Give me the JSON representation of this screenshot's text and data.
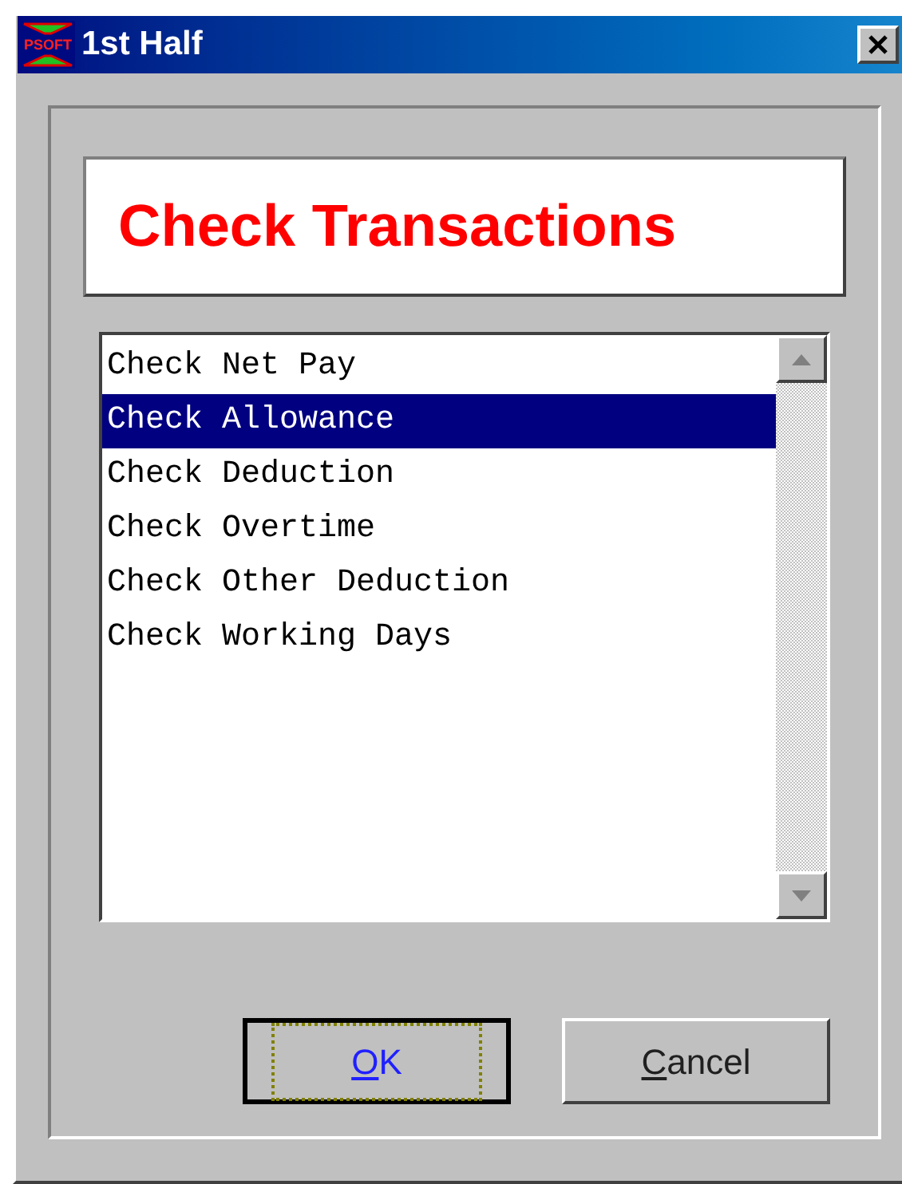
{
  "window": {
    "title": "1st Half",
    "logo_text": "PSOFT"
  },
  "header": {
    "title": "Check Transactions"
  },
  "list": {
    "items": [
      {
        "label": "Check Net Pay",
        "selected": false
      },
      {
        "label": "Check Allowance",
        "selected": true
      },
      {
        "label": "Check Deduction",
        "selected": false
      },
      {
        "label": "Check Overtime",
        "selected": false
      },
      {
        "label": "Check Other Deduction",
        "selected": false
      },
      {
        "label": "Check Working Days",
        "selected": false
      }
    ]
  },
  "buttons": [
    {
      "mnemonic": "O",
      "rest": "K",
      "focused": true
    },
    {
      "mnemonic": "C",
      "rest": "ancel",
      "focused": false
    }
  ]
}
